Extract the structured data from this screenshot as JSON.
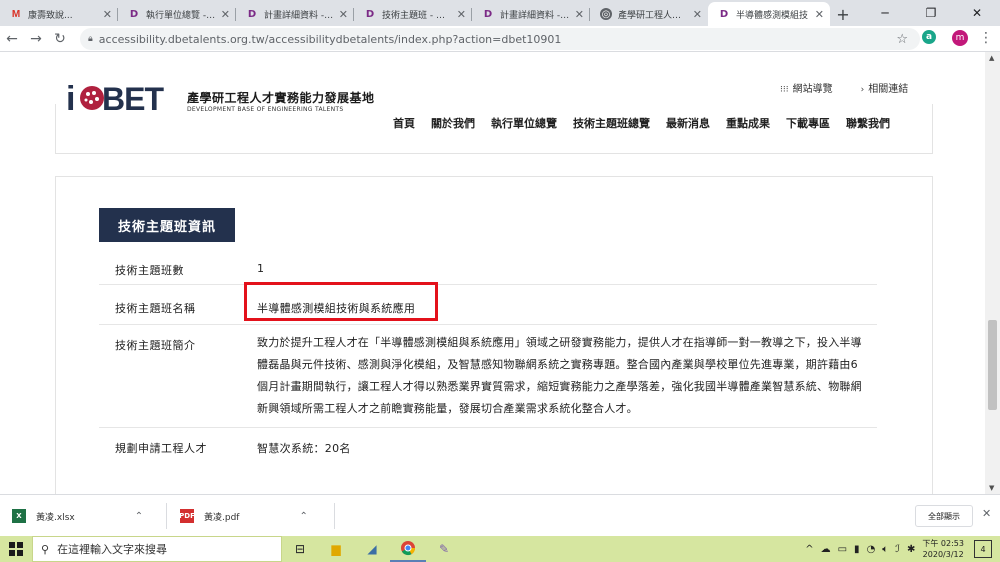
{
  "browser": {
    "tabs": [
      {
        "title": "康壽致說...",
        "icon": "gmail-icon"
      },
      {
        "title": "執行單位總覽 - 產",
        "icon": "dbet-icon"
      },
      {
        "title": "計畫詳細資料 - 產",
        "icon": "dbet-icon"
      },
      {
        "title": "技術主題班 - 產學",
        "icon": "dbet-icon"
      },
      {
        "title": "計畫詳細資料 - 產",
        "icon": "dbet-icon"
      },
      {
        "title": "產學研工程人才實",
        "icon": "globe-icon"
      },
      {
        "title": "半導體感測模組技",
        "icon": "dbet-icon",
        "active": true
      }
    ],
    "url": "accessibility.dbetalents.org.tw/accessibilitydbetalents/index.php?action=dbet10901",
    "extension_letter": "a",
    "profile_letter": "m"
  },
  "site": {
    "logo_text": "iDBET",
    "name": "產學研工程人才實務能力發展基地",
    "name_en": "DEVELOPMENT BASE OF ENGINEERING TALENTS",
    "util_links": [
      "網站導覽",
      "相關連結"
    ],
    "nav": [
      "首頁",
      "關於我們",
      "執行單位總覽",
      "技術主題班總覽",
      "最新消息",
      "重點成果",
      "下載專區",
      "聯繫我們"
    ]
  },
  "section": {
    "title": "技術主題班資訊",
    "rows": {
      "count_label": "技術主題班數",
      "count_value": "1",
      "name_label": "技術主題班名稱",
      "name_value": "半導體感測模組技術與系統應用",
      "intro_label": "技術主題班簡介",
      "intro_value": "致力於提升工程人才在「半導體感測模組與系統應用」領域之研發實務能力，提供人才在指導師一對一教導之下，投入半導體磊晶與元件技術、感測與淨化模組，及智慧感知物聯網系統之實務專題。整合國內產業與學校單位先進專業，期許藉由6個月計畫期間執行，讓工程人才得以熟悉業界實質需求，縮短實務能力之產學落差，強化我國半導體產業智慧系統、物聯網新興領域所需工程人才之前瞻實務能量，發展切合產業需求系統化整合人才。",
      "plan_label": "規劃申請工程人才",
      "plan_value": "智慧次系統：20名"
    }
  },
  "downloads": {
    "items": [
      {
        "name": "黃凌.xlsx",
        "type": "excel"
      },
      {
        "name": "黃凌.pdf",
        "type": "pdf"
      }
    ],
    "show_all": "全部顯示"
  },
  "taskbar": {
    "search_placeholder": "在這裡輸入文字來搜尋",
    "time": "下午 02:53",
    "date": "2020/3/12",
    "notifications": "4"
  },
  "colors": {
    "section_bg": "#23314d",
    "highlight": "#e3111b",
    "taskbar": "#d6e6a0"
  }
}
